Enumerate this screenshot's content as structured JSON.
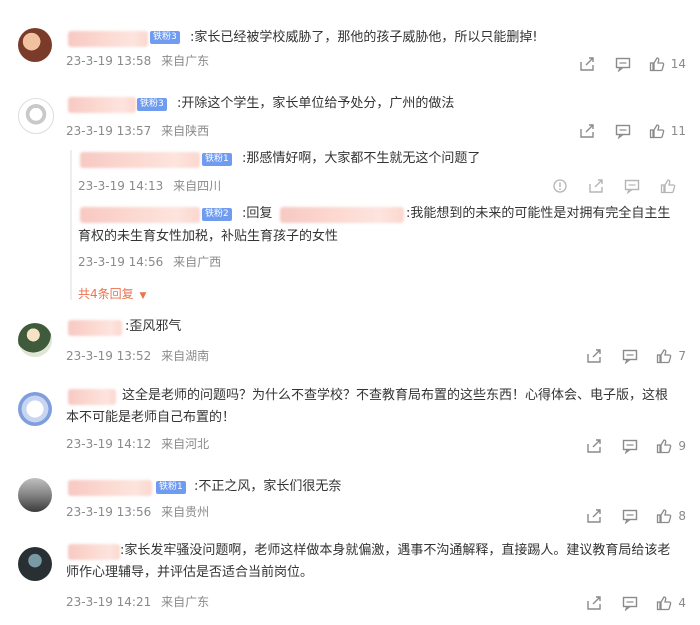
{
  "comments": [
    {
      "badge": "铁粉3",
      "text": ":家长已经被学校威胁了，那他的孩子威胁他，所以只能删掉!",
      "time": "23-3-19 13:58",
      "location": "来自广东",
      "likes": "14"
    },
    {
      "badge": "铁粉3",
      "text": ":开除这个学生，家长单位给予处分，广州的做法",
      "time": "23-3-19 13:57",
      "location": "来自陕西",
      "likes": "11",
      "replies": [
        {
          "badge": "铁粉1",
          "text": ":那感情好啊，大家都不生就无这个问题了",
          "time": "23-3-19 14:13",
          "location": "来自四川"
        },
        {
          "badge": "铁粉2",
          "reply_prefix": ":回复",
          "text": ":我能想到的未来的可能性是对拥有完全自主生",
          "text2": "育权的未生育女性加税，补贴生育孩子的女性",
          "time": "23-3-19 14:56",
          "location": "来自广西"
        }
      ],
      "more_replies": "共4条回复"
    },
    {
      "text": ":歪风邪气",
      "time": "23-3-19 13:52",
      "location": "来自湖南",
      "likes": "7"
    },
    {
      "text": "这全是老师的问题吗？为什么不查学校？不查教育局布置的这些东西！心得体会、电子版，这根",
      "text2": "本不可能是老师自己布置的！",
      "time": "23-3-19 14:12",
      "location": "来自河北",
      "likes": "9"
    },
    {
      "badge": "铁粉1",
      "text": ":不正之风，家长们很无奈",
      "time": "23-3-19 13:56",
      "location": "来自贵州",
      "likes": "8"
    },
    {
      "text": ":家长发牢骚没问题啊，老师这样做本身就偏激，遇事不沟通解释，直接踢人。建议教育局给该老",
      "text2": "师作心理辅导，并评估是否适合当前岗位。",
      "time": "23-3-19 14:21",
      "location": "来自广东",
      "likes": "4"
    }
  ]
}
